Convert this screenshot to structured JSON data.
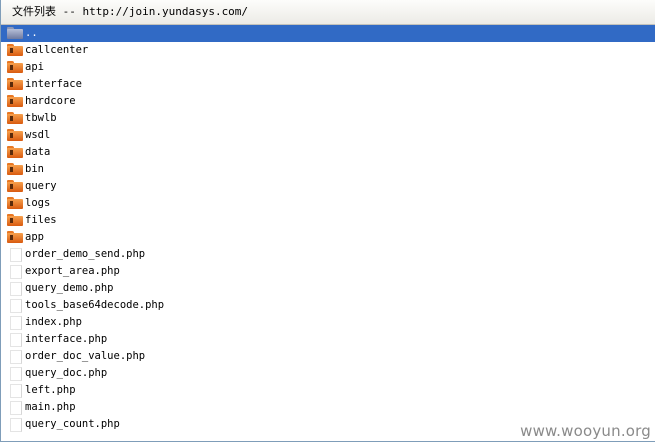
{
  "window": {
    "title": "文件列表 -- http://join.yundasys.com/"
  },
  "colors": {
    "selection": "#316ac5",
    "folder": "#e87722",
    "border": "#7f9db9"
  },
  "entries": [
    {
      "name": "..",
      "type": "parent-folder",
      "selected": true
    },
    {
      "name": "callcenter",
      "type": "folder"
    },
    {
      "name": "api",
      "type": "folder"
    },
    {
      "name": "interface",
      "type": "folder"
    },
    {
      "name": "hardcore",
      "type": "folder"
    },
    {
      "name": "tbwlb",
      "type": "folder"
    },
    {
      "name": "wsdl",
      "type": "folder"
    },
    {
      "name": "data",
      "type": "folder"
    },
    {
      "name": "bin",
      "type": "folder"
    },
    {
      "name": "query",
      "type": "folder"
    },
    {
      "name": "logs",
      "type": "folder"
    },
    {
      "name": "files",
      "type": "folder"
    },
    {
      "name": "app",
      "type": "folder"
    },
    {
      "name": "order_demo_send.php",
      "type": "file"
    },
    {
      "name": "export_area.php",
      "type": "file"
    },
    {
      "name": "query_demo.php",
      "type": "file"
    },
    {
      "name": "tools_base64decode.php",
      "type": "file"
    },
    {
      "name": "index.php",
      "type": "file"
    },
    {
      "name": "interface.php",
      "type": "file"
    },
    {
      "name": "order_doc_value.php",
      "type": "file"
    },
    {
      "name": "query_doc.php",
      "type": "file"
    },
    {
      "name": "left.php",
      "type": "file"
    },
    {
      "name": "main.php",
      "type": "file"
    },
    {
      "name": "query_count.php",
      "type": "file"
    }
  ],
  "watermark": "www.wooyun.org"
}
